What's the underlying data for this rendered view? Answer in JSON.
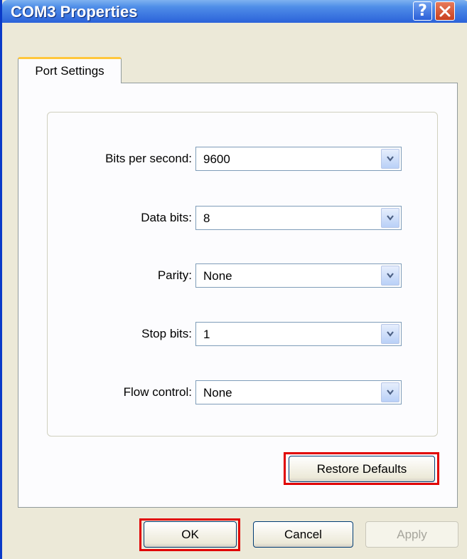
{
  "window": {
    "title": "COM3 Properties",
    "help_glyph": "?",
    "accent_title_color": "#2b62d9",
    "highlight_color": "#e00000"
  },
  "tabs": [
    {
      "label": "Port Settings",
      "selected": true
    }
  ],
  "settings": [
    {
      "label": "Bits per second:",
      "value": "9600"
    },
    {
      "label": "Data bits:",
      "value": "8"
    },
    {
      "label": "Parity:",
      "value": "None"
    },
    {
      "label": "Stop bits:",
      "value": "1"
    },
    {
      "label": "Flow control:",
      "value": "None"
    }
  ],
  "buttons": {
    "restore_defaults": "Restore Defaults",
    "ok": "OK",
    "cancel": "Cancel",
    "apply": "Apply"
  },
  "icons": {
    "help": "help-icon",
    "close": "close-icon",
    "dropdown": "chevron-down-icon"
  }
}
